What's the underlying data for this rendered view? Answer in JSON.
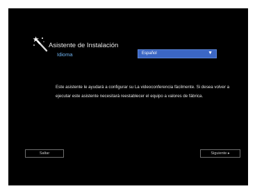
{
  "wizard": {
    "title": "Asistente de Instalación",
    "language_label": "Idioma",
    "language_value": "Español",
    "description": "Este asistente le ayudará a configurar su La videoconferencia fácilmente. Si desea volver a ejecutar este asistente necesitará reestablecer el equipo a valores de fábrica."
  },
  "buttons": {
    "skip_label": "Saltar",
    "next_label": "Siguiente ▸"
  },
  "icons": {
    "wizard": "magic-wand-icon",
    "dropdown": "triangle-down-icon"
  },
  "colors": {
    "background": "#000000",
    "accent_label": "#6fb3f0",
    "select_bg": "#3b66c4"
  }
}
